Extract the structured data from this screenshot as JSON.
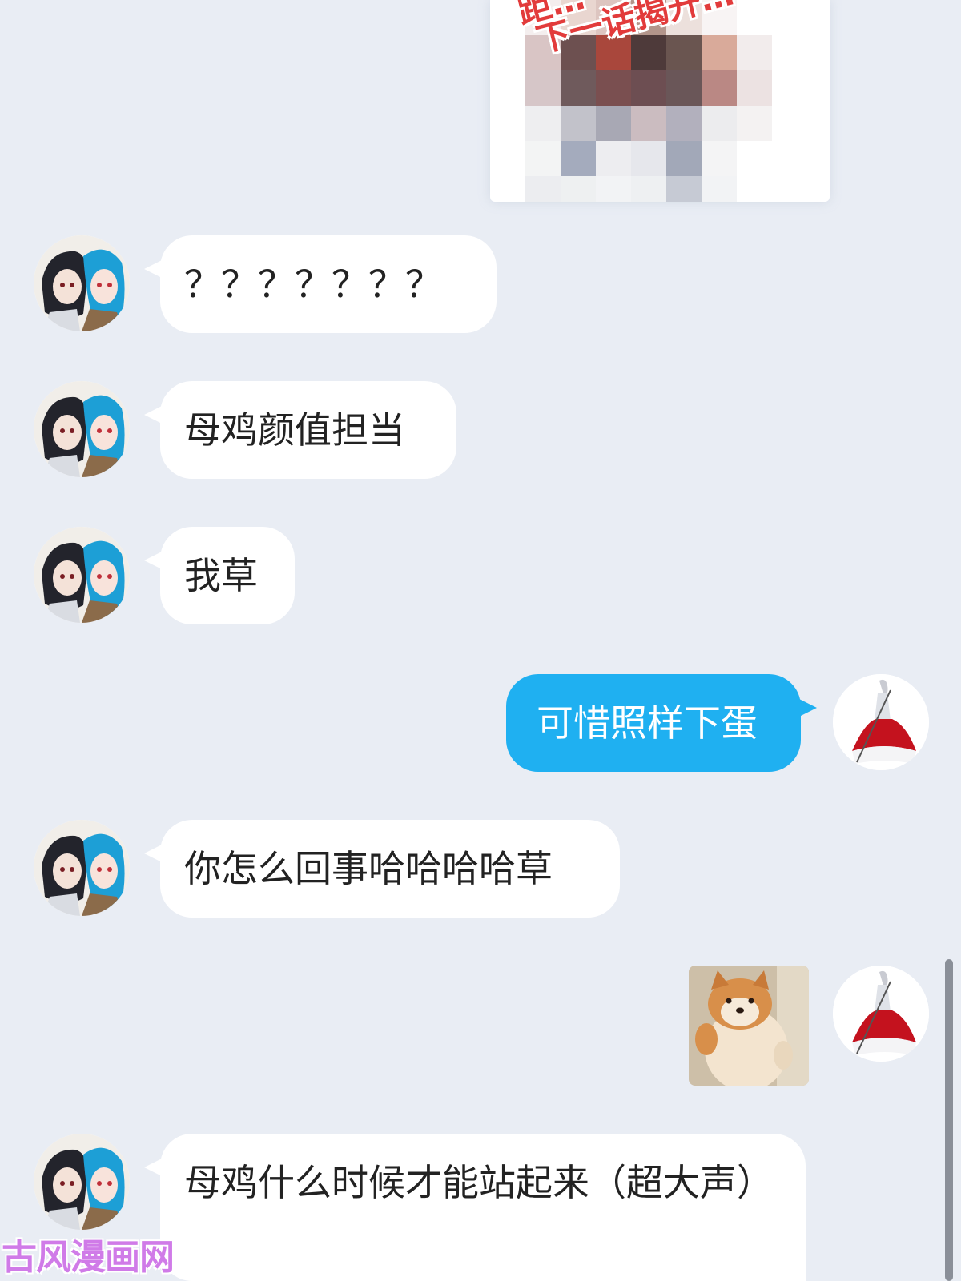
{
  "colors": {
    "background": "#e9edf4",
    "bubble_received": "#ffffff",
    "bubble_sent": "#1fb0f1",
    "watermark": "#d07be8"
  },
  "top_image": {
    "caption_line1": "距…",
    "caption_line2": "下一话揭开…"
  },
  "messages": [
    {
      "side": "left",
      "avatar": "anime-duo-avatar",
      "text": "？？？？？？？"
    },
    {
      "side": "left",
      "avatar": "anime-duo-avatar",
      "text": "母鸡颜值担当"
    },
    {
      "side": "left",
      "avatar": "anime-duo-avatar",
      "text": "我草"
    },
    {
      "side": "right",
      "avatar": "white-red-dress-avatar",
      "text": "可惜照样下蛋"
    },
    {
      "side": "left",
      "avatar": "anime-duo-avatar",
      "text": "你怎么回事哈哈哈哈草"
    },
    {
      "side": "right",
      "avatar": "white-red-dress-avatar",
      "sticker": "shiba-dog-sticker"
    },
    {
      "side": "left",
      "avatar": "anime-duo-avatar",
      "text": "母鸡什么时候才能站起来（超大声）"
    }
  ],
  "watermark": "古风漫画网"
}
